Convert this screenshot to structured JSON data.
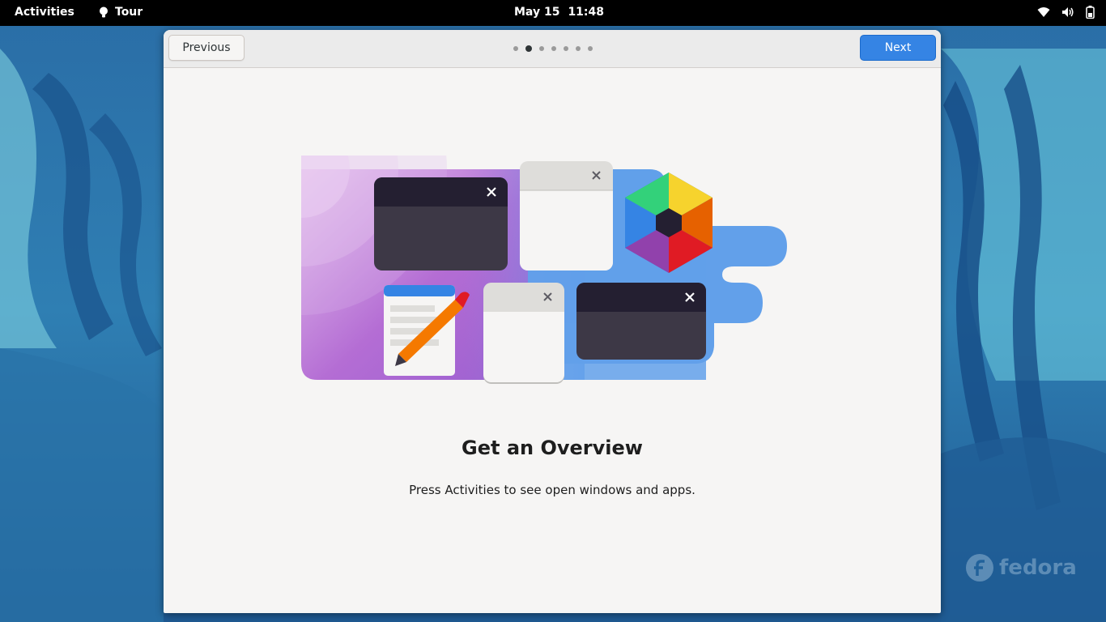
{
  "topbar": {
    "activities_label": "Activities",
    "app_name": "Tour",
    "date": "May 15",
    "time": "11:48",
    "tray_icons": [
      "wifi-icon",
      "volume-icon",
      "battery-icon"
    ]
  },
  "window": {
    "previous_label": "Previous",
    "next_label": "Next",
    "pages": {
      "total": 7,
      "current": 2
    },
    "page": {
      "title": "Get an Overview",
      "description": "Press Activities to see open windows and apps."
    }
  },
  "desktop": {
    "watermark": "fedora"
  },
  "colors": {
    "accent": "#3584e4",
    "topbar": "#000000",
    "window_bg": "#f6f5f4"
  }
}
